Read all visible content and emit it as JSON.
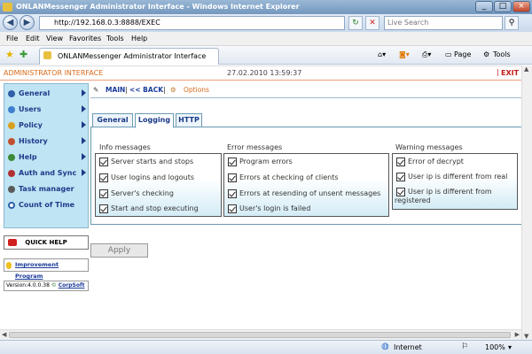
{
  "browser": {
    "title": "ONLANMessenger Administrator Interface - Windows Internet Explorer",
    "url": "http://192.168.0.3:8888/EXEC",
    "search_placeholder": "Live Search",
    "menu": [
      "File",
      "Edit",
      "View",
      "Favorites",
      "Tools",
      "Help"
    ],
    "tab_title": "ONLANMessenger Administrator Interface",
    "cmd_page": "Page",
    "cmd_tools": "Tools",
    "status_zone": "Internet",
    "zoom": "100%"
  },
  "app": {
    "header_title": "ADMINISTRATOR INTERFACE",
    "datetime": "27.02.2010 13:59:37",
    "exit_label": "EXIT",
    "sidebar": [
      {
        "label": "General",
        "arrow": true
      },
      {
        "label": "Users",
        "arrow": true
      },
      {
        "label": "Policy",
        "arrow": true
      },
      {
        "label": "History",
        "arrow": true
      },
      {
        "label": "Help",
        "arrow": true
      },
      {
        "label": "Auth and Sync",
        "arrow": true
      },
      {
        "label": "Task manager",
        "arrow": false
      },
      {
        "label": "Count of Time",
        "arrow": false
      }
    ],
    "quick_help": "QUICK HELP",
    "improvement": "Improvement Program",
    "version": "Version:4.0.0.38",
    "corpsoft": "CorpSoft",
    "nav_main": "MAIN",
    "nav_back": "<< BACK",
    "nav_options": "Options",
    "tabs": [
      "General",
      "Logging",
      "HTTP"
    ],
    "groups": [
      {
        "title": "Info messages",
        "items": [
          "Server starts and stops",
          "User logins and logouts",
          "Server's checking",
          "Start and stop executing"
        ]
      },
      {
        "title": "Error messages",
        "items": [
          "Program errors",
          "Errors at checking of clients",
          "Errors at resending of unsent messages",
          "User's login is failed"
        ]
      },
      {
        "title": "Warning messages",
        "items": [
          "Error of decrypt",
          "User ip is different from real",
          "User ip is different from registered"
        ]
      }
    ],
    "apply_label": "Apply"
  }
}
